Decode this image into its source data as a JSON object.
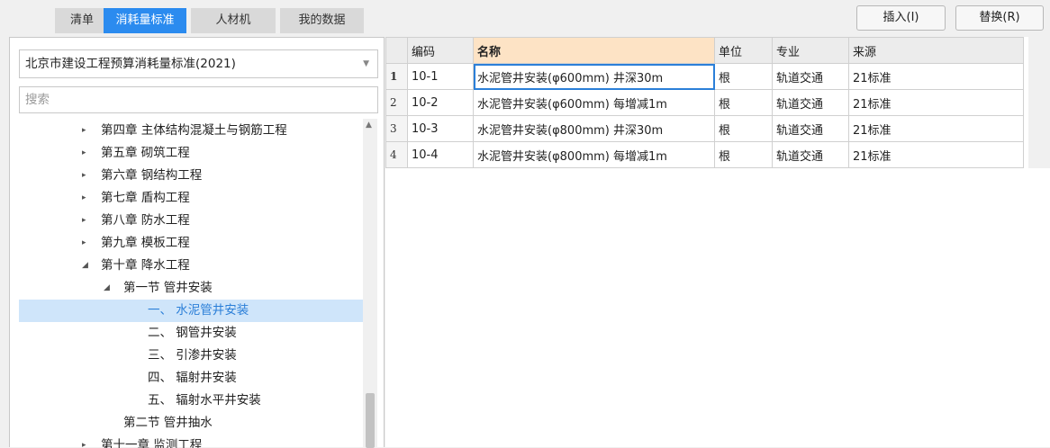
{
  "tabs": [
    {
      "label": "清单",
      "active": false
    },
    {
      "label": "消耗量标准",
      "active": true
    },
    {
      "label": "人材机",
      "active": false
    },
    {
      "label": "我的数据",
      "active": false
    }
  ],
  "buttons": {
    "insert": "插入(I)",
    "replace": "替换(R)"
  },
  "standard_select": {
    "value": "北京市建设工程预算消耗量标准(2021)"
  },
  "search": {
    "placeholder": "搜索"
  },
  "tree": [
    {
      "label": "第四章 主体结构混凝土与钢筋工程",
      "arrow": "▸"
    },
    {
      "label": "第五章 砌筑工程",
      "arrow": "▸"
    },
    {
      "label": "第六章 钢结构工程",
      "arrow": "▸"
    },
    {
      "label": "第七章 盾构工程",
      "arrow": "▸"
    },
    {
      "label": "第八章 防水工程",
      "arrow": "▸"
    },
    {
      "label": "第九章 模板工程",
      "arrow": "▸"
    },
    {
      "label": "第十章 降水工程",
      "arrow": "◢"
    },
    {
      "label": "第一节 管井安装",
      "arrow": "◢"
    },
    {
      "label": "一、 水泥管井安装",
      "arrow": ""
    },
    {
      "label": "二、 钢管井安装",
      "arrow": ""
    },
    {
      "label": "三、 引渗井安装",
      "arrow": ""
    },
    {
      "label": "四、 辐射井安装",
      "arrow": ""
    },
    {
      "label": "五、 辐射水平井安装",
      "arrow": ""
    },
    {
      "label": "第二节 管井抽水",
      "arrow": ""
    },
    {
      "label": "第十一章 监测工程",
      "arrow": "▸"
    }
  ],
  "table": {
    "headers": [
      "编码",
      "名称",
      "单位",
      "专业",
      "来源"
    ],
    "rows": [
      {
        "num": "1",
        "code": "10-1",
        "name": "水泥管井安装(φ600mm) 井深30m",
        "unit": "根",
        "specialty": "轨道交通",
        "source": "21标准"
      },
      {
        "num": "2",
        "code": "10-2",
        "name": "水泥管井安装(φ600mm) 每增减1m",
        "unit": "根",
        "specialty": "轨道交通",
        "source": "21标准"
      },
      {
        "num": "3",
        "code": "10-3",
        "name": "水泥管井安装(φ800mm) 井深30m",
        "unit": "根",
        "specialty": "轨道交通",
        "source": "21标准"
      },
      {
        "num": "4",
        "code": "10-4",
        "name": "水泥管井安装(φ800mm) 每增减1m",
        "unit": "根",
        "specialty": "轨道交通",
        "source": "21标准"
      }
    ]
  },
  "colors": {
    "accent": "#2b8bef",
    "selected_bg": "#cfe5fa",
    "name_header_bg": "#fde3c5"
  }
}
